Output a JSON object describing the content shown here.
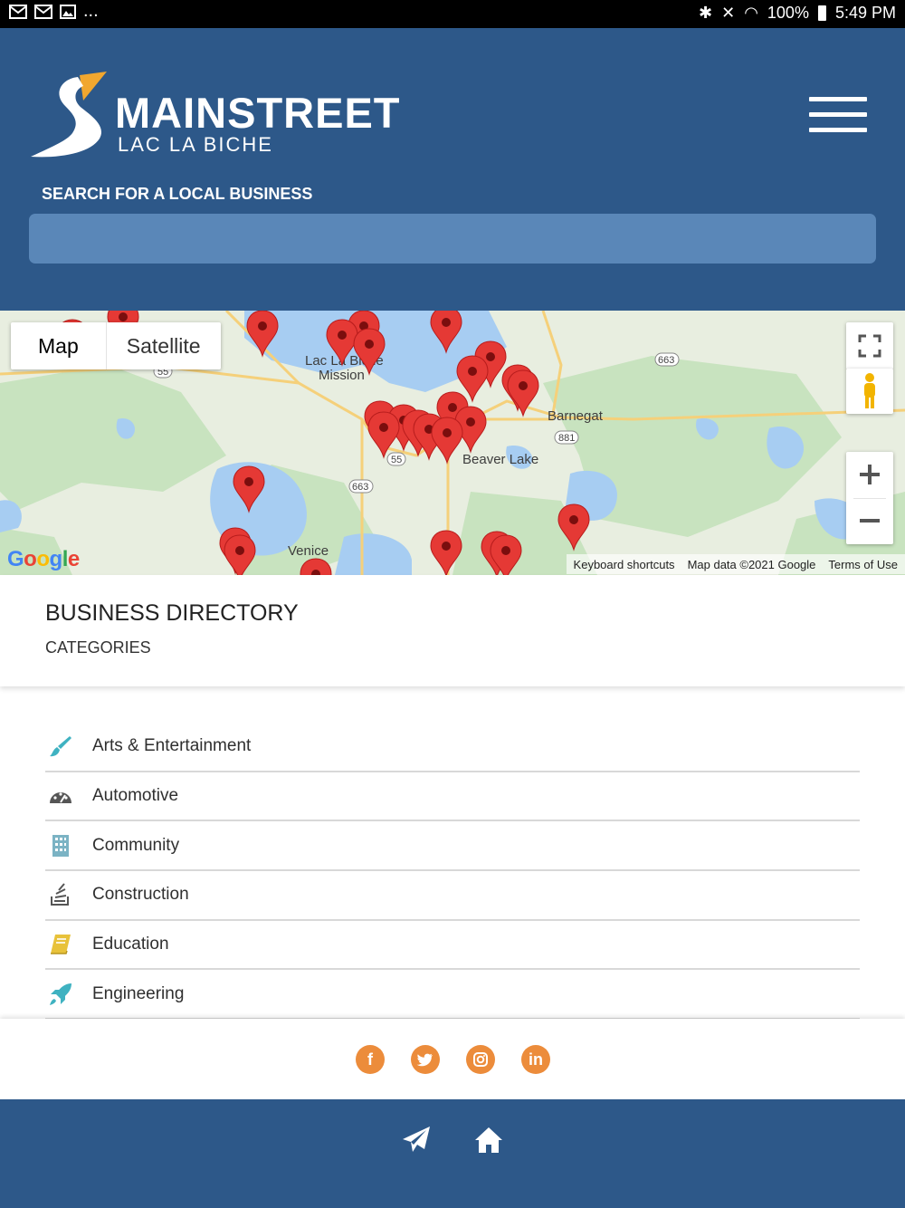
{
  "status_bar": {
    "battery_percent": "100%",
    "time": "5:49 PM",
    "overflow": "..."
  },
  "header": {
    "logo_title": "MAINSTREET",
    "logo_subtitle": "LAC LA BICHE",
    "search_label": "SEARCH FOR A LOCAL BUSINESS",
    "search_value": "",
    "search_placeholder": ""
  },
  "map": {
    "type_buttons": [
      "Map",
      "Satellite"
    ],
    "active_type": "Map",
    "places": [
      "Lac La Biche",
      "Mission",
      "Barnegat",
      "Beaver Lake",
      "Venice"
    ],
    "road_shields": [
      "55",
      "663",
      "881",
      "55",
      "663"
    ],
    "google_logo": "Google",
    "footer": [
      "Keyboard shortcuts",
      "Map data ©2021 Google",
      "Terms of Use"
    ]
  },
  "directory": {
    "title": "BUSINESS DIRECTORY",
    "subtitle": "CATEGORIES",
    "categories": [
      {
        "label": "Arts & Entertainment",
        "icon": "paintbrush-icon",
        "color": "#3fb2c1"
      },
      {
        "label": "Automotive",
        "icon": "dashboard-icon",
        "color": "#555555"
      },
      {
        "label": "Community",
        "icon": "building-icon",
        "color": "#7bb3c4"
      },
      {
        "label": "Construction",
        "icon": "stack-icon",
        "color": "#555555"
      },
      {
        "label": "Education",
        "icon": "book-icon",
        "color": "#e8c23a"
      },
      {
        "label": "Engineering",
        "icon": "rocket-icon",
        "color": "#3fb2c1"
      }
    ]
  },
  "social": [
    {
      "name": "facebook-icon",
      "glyph": "f"
    },
    {
      "name": "twitter-icon",
      "glyph": "t"
    },
    {
      "name": "instagram-icon",
      "glyph": "◎"
    },
    {
      "name": "linkedin-icon",
      "glyph": "in"
    }
  ],
  "colors": {
    "brand_blue": "#2d5889",
    "search_blue": "#5a87b8",
    "social_orange": "#ec8c3b",
    "pin_red": "#e53935"
  }
}
